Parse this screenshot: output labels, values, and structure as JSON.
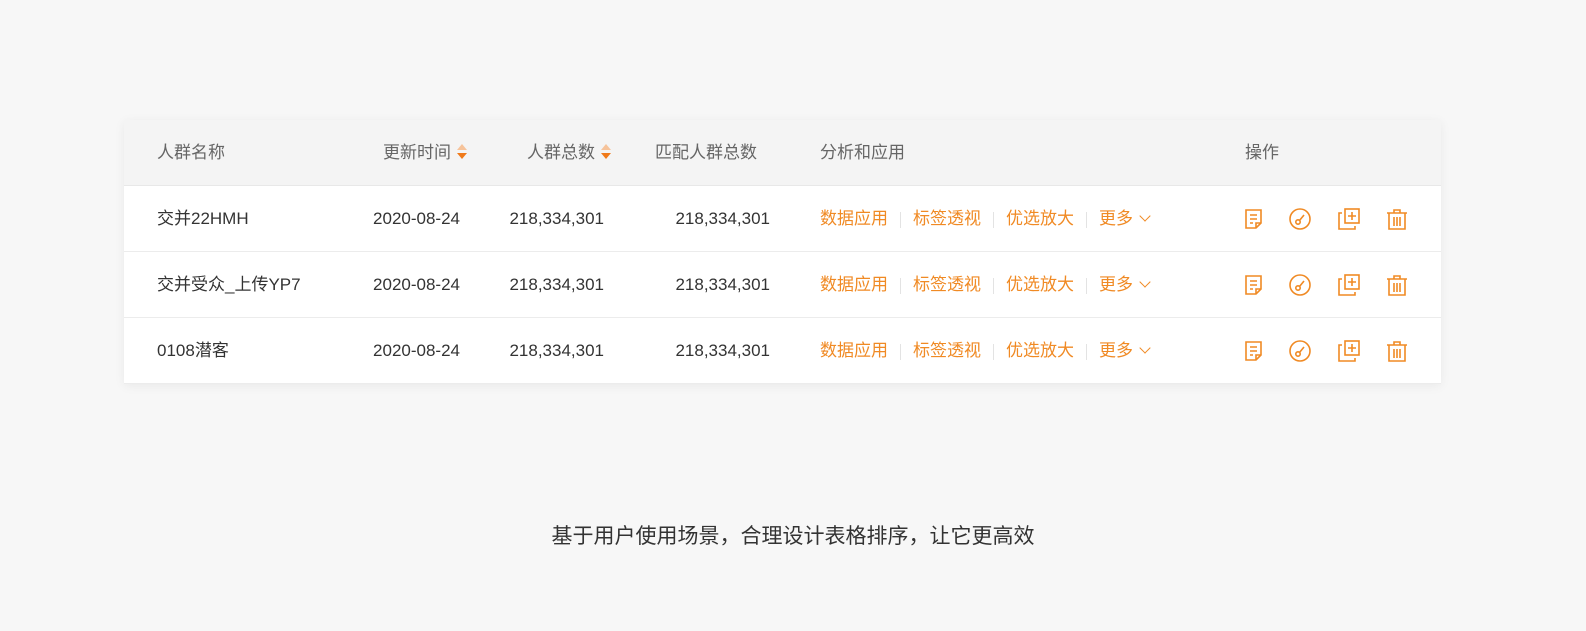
{
  "table": {
    "headers": {
      "name": "人群名称",
      "updated": "更新时间",
      "total": "人群总数",
      "matched": "匹配人群总数",
      "analysis": "分析和应用",
      "actions": "操作"
    },
    "rows": [
      {
        "name": "交并22HMH",
        "updated": "2020-08-24",
        "total": "218,334,301",
        "matched": "218,334,301"
      },
      {
        "name": "交并受众_上传YP7",
        "updated": "2020-08-24",
        "total": "218,334,301",
        "matched": "218,334,301"
      },
      {
        "name": "0108潜客",
        "updated": "2020-08-24",
        "total": "218,334,301",
        "matched": "218,334,301"
      }
    ],
    "links": {
      "data_apply": "数据应用",
      "tag_view": "标签透视",
      "expand": "优选放大",
      "more": "更多"
    },
    "action_icons": [
      "document-icon",
      "key-icon",
      "copy-add-icon",
      "trash-icon"
    ]
  },
  "caption": "基于用户使用场景，合理设计表格排序，让它更高效",
  "colors": {
    "accent": "#f08a24",
    "background": "#f7f7f7"
  }
}
